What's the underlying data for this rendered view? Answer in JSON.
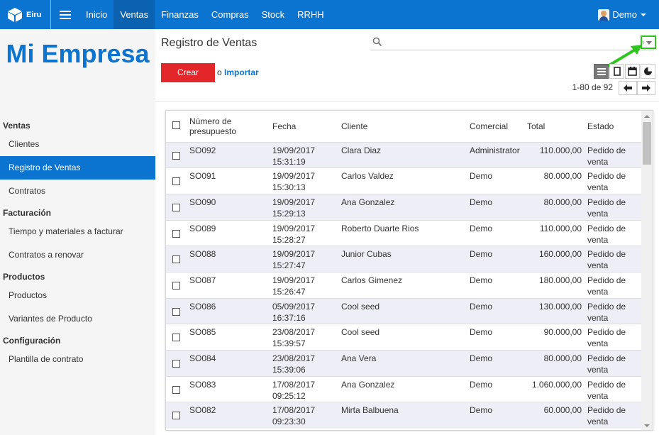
{
  "nav": {
    "brand": "Eiru",
    "items": [
      "Inicio",
      "Ventas",
      "Finanzas",
      "Compras",
      "Stock",
      "RRHH"
    ],
    "active": 1,
    "user": "Demo"
  },
  "sidebar": {
    "company": "Mi Empresa",
    "sections": [
      {
        "title": "Ventas",
        "items": [
          "Clientes",
          "Registro de Ventas",
          "Contratos"
        ]
      },
      {
        "title": "Facturación",
        "items": [
          "Tiempo y materiales a facturar",
          "Contratos a renovar"
        ]
      },
      {
        "title": "Productos",
        "items": [
          "Productos",
          "Variantes de Producto"
        ]
      },
      {
        "title": "Configuración",
        "items": [
          "Plantilla de contrato"
        ]
      }
    ],
    "active_item": "Registro de Ventas"
  },
  "header": {
    "title": "Registro de Ventas",
    "create_label": "Crear",
    "or_label": "o",
    "import_label": "Importar",
    "pager": "1-80 de 92"
  },
  "table": {
    "columns": [
      "Número de presupuesto",
      "Fecha",
      "Cliente",
      "Comercial",
      "Total",
      "Estado"
    ],
    "rows": [
      [
        "SO092",
        "19/09/2017 15:31:19",
        "Clara Diaz",
        "Administrator",
        "110.000,00",
        "Pedido de venta"
      ],
      [
        "SO091",
        "19/09/2017 15:30:13",
        "Carlos Valdez",
        "Demo",
        "80.000,00",
        "Pedido de venta"
      ],
      [
        "SO090",
        "19/09/2017 15:29:13",
        "Ana Gonzalez",
        "Demo",
        "80.000,00",
        "Pedido de venta"
      ],
      [
        "SO089",
        "19/09/2017 15:28:27",
        "Roberto Duarte Rios",
        "Demo",
        "110.000,00",
        "Pedido de venta"
      ],
      [
        "SO088",
        "19/09/2017 15:27:47",
        "Junior Cubas",
        "Demo",
        "160.000,00",
        "Pedido de venta"
      ],
      [
        "SO087",
        "19/09/2017 15:26:47",
        "Carlos Gimenez",
        "Demo",
        "180.000,00",
        "Pedido de venta"
      ],
      [
        "SO086",
        "05/09/2017 16:37:16",
        "Cool seed",
        "Demo",
        "130.000,00",
        "Pedido de venta"
      ],
      [
        "SO085",
        "23/08/2017 15:39:57",
        "Cool seed",
        "Demo",
        "90.000,00",
        "Pedido de venta"
      ],
      [
        "SO084",
        "23/08/2017 15:39:06",
        "Ana Vera",
        "Demo",
        "80.000,00",
        "Pedido de venta"
      ],
      [
        "SO083",
        "17/08/2017 09:25:12",
        "Ana Gonzalez",
        "Demo",
        "1.060.000,00",
        "Pedido de venta"
      ],
      [
        "SO082",
        "17/08/2017 09:23:30",
        "Mirta Balbuena",
        "Demo",
        "60.000,00",
        "Pedido de venta"
      ]
    ]
  },
  "colors": {
    "primary": "#0b74d1",
    "create": "#e3262a",
    "annotation": "#2fc41e",
    "row_alt": "#eeeef6"
  }
}
